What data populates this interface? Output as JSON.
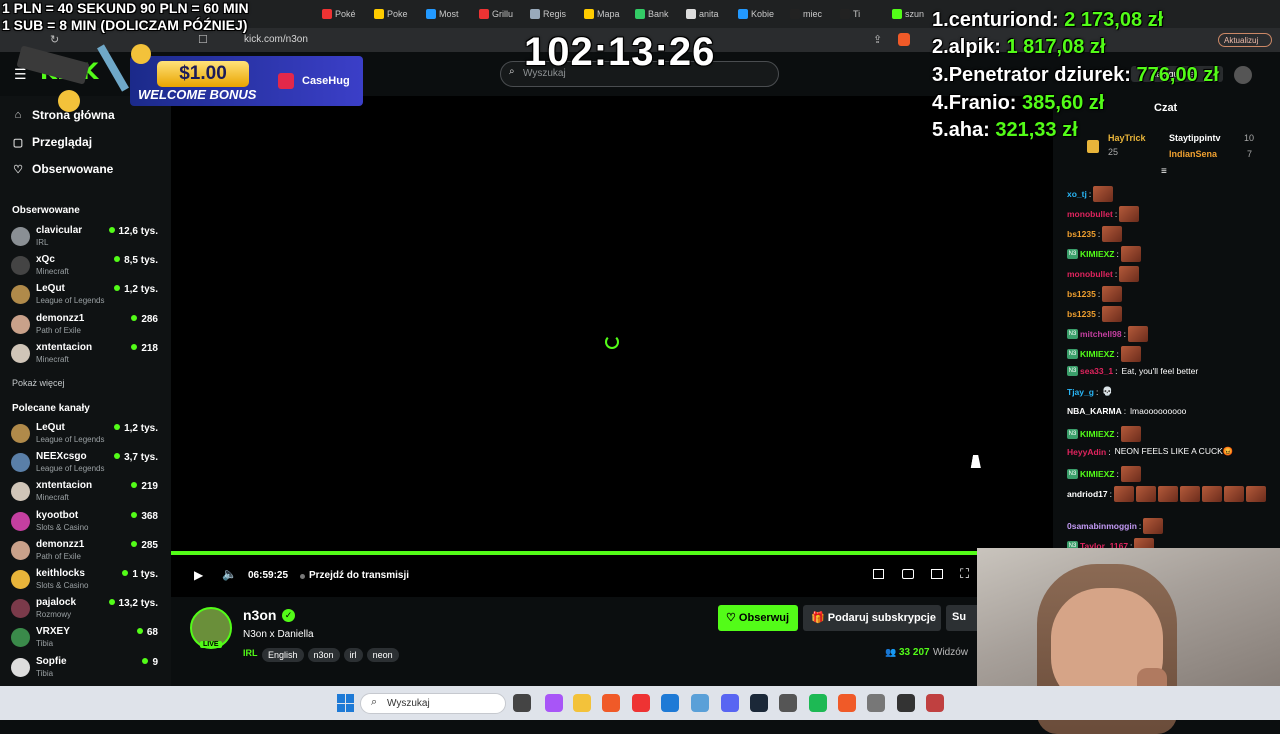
{
  "browser": {
    "tabs": [
      {
        "label": "Poké",
        "color": "#e33"
      },
      {
        "label": "Poke",
        "color": "#fc0"
      },
      {
        "label": "Most",
        "color": "#29f"
      },
      {
        "label": "Grillu",
        "color": "#e33"
      },
      {
        "label": "Regis",
        "color": "#9ab"
      },
      {
        "label": "Mapa",
        "color": "#fc0"
      },
      {
        "label": "Bank",
        "color": "#3c6"
      },
      {
        "label": "anita",
        "color": "#ddd"
      },
      {
        "label": "Kobie",
        "color": "#29f"
      },
      {
        "label": "miec",
        "color": "#222"
      },
      {
        "label": "Ti",
        "color": "#222"
      },
      {
        "label": "szun",
        "color": "#53fc18"
      }
    ],
    "url": "kick.com/n3on",
    "update_button": "Aktualizuj"
  },
  "overlay": {
    "donation_line1": "1 PLN =  40 SEKUND 90 PLN = 60 MIN",
    "donation_line2": "1 SUB = 8 MIN (DOLICZAM PÓŹNIEJ)",
    "timer": "102:13:26",
    "casehug_amount": "$1.00",
    "casehug_text": "WELCOME BONUS",
    "casehug_brand": "CaseHug",
    "leaderboard": [
      {
        "rank": "1.",
        "name": "centuriond:",
        "amount": "2 173,08 zł"
      },
      {
        "rank": "2.",
        "name": "alpik:",
        "amount": "1 817,08 zł"
      },
      {
        "rank": "3.",
        "name": "Penetrator dziurek:",
        "amount": "776,00 zł"
      },
      {
        "rank": "4.",
        "name": "Franio:",
        "amount": "385,60 zł"
      },
      {
        "rank": "5.",
        "name": "aha:",
        "amount": "321,33 zł"
      }
    ]
  },
  "header": {
    "search_placeholder": "Wyszukaj",
    "login_label": "Zaloguj się"
  },
  "sidebar": {
    "nav": [
      {
        "label": "Strona główna",
        "icon": "home-icon",
        "glyph": "⌂"
      },
      {
        "label": "Przeglądaj",
        "icon": "browse-icon",
        "glyph": "▢"
      },
      {
        "label": "Obserwowane",
        "icon": "heart-icon",
        "glyph": "♡"
      }
    ],
    "followed_title": "Obserwowane",
    "followed": [
      {
        "name": "clavicular",
        "category": "IRL",
        "viewers": "12,6 tys.",
        "color": "#8a8f94"
      },
      {
        "name": "xQc",
        "category": "Minecraft",
        "viewers": "8,5 tys.",
        "color": "#444"
      },
      {
        "name": "LeQut",
        "category": "League of Legends",
        "viewers": "1,2 tys.",
        "color": "#b08a4a"
      },
      {
        "name": "demonzz1",
        "category": "Path of Exile",
        "viewers": "286",
        "color": "#c9a18a"
      },
      {
        "name": "xntentacion",
        "category": "Minecraft",
        "viewers": "218",
        "color": "#d0c5b8"
      }
    ],
    "show_more": "Pokaż więcej",
    "recommended_title": "Polecane kanały",
    "recommended": [
      {
        "name": "LeQut",
        "category": "League of Legends",
        "viewers": "1,2 tys.",
        "color": "#b08a4a"
      },
      {
        "name": "NEEXcsgo",
        "category": "League of Legends",
        "viewers": "3,7 tys.",
        "color": "#5a7fa8"
      },
      {
        "name": "xntentacion",
        "category": "Minecraft",
        "viewers": "219",
        "color": "#d0c5b8"
      },
      {
        "name": "kyootbot",
        "category": "Slots & Casino",
        "viewers": "368",
        "color": "#c43fa0"
      },
      {
        "name": "demonzz1",
        "category": "Path of Exile",
        "viewers": "285",
        "color": "#c9a18a"
      },
      {
        "name": "keithlocks",
        "category": "Slots & Casino",
        "viewers": "1 tys.",
        "color": "#e8b43a"
      },
      {
        "name": "pajalock",
        "category": "Rozmowy",
        "viewers": "13,2 tys.",
        "color": "#7a3a4a"
      },
      {
        "name": "VRXEY",
        "category": "Tibia",
        "viewers": "68",
        "color": "#3a8a4a"
      },
      {
        "name": "Sopfie",
        "category": "Tibia",
        "viewers": "9",
        "color": "#ddd"
      }
    ]
  },
  "player": {
    "time": "06:59:25",
    "go_live": "Przejdź do transmisji",
    "progress": 1.0
  },
  "channel": {
    "name": "n3on",
    "title": "N3on x Daniella",
    "live_badge": "LIVE",
    "category": "IRL",
    "tags": [
      "English",
      "n3on",
      "irl",
      "neon"
    ],
    "follow_label": "Obserwuj",
    "gift_label": "Podaruj subskrypcje",
    "sub_label": "Su",
    "viewers": "33 207",
    "viewers_label": "Widzów"
  },
  "chat": {
    "title": "Czat",
    "top_gifters": [
      {
        "name": "HayTrick",
        "count": "25"
      },
      {
        "name": "Staytippintv",
        "count": "10"
      },
      {
        "name": "IndianSena",
        "count": "7"
      }
    ],
    "messages": [
      {
        "user": "xo_tj",
        "color": "#29b6f6",
        "text": "",
        "emotes": 1,
        "badge": false
      },
      {
        "user": "monobullet",
        "color": "#e0245e",
        "text": "",
        "emotes": 1,
        "badge": false
      },
      {
        "user": "bs1235",
        "color": "#f0a030",
        "text": "",
        "emotes": 1,
        "badge": false
      },
      {
        "user": "KIMIEXZ",
        "color": "#53fc18",
        "text": "",
        "emotes": 1,
        "badge": true
      },
      {
        "user": "monobullet",
        "color": "#e0245e",
        "text": "",
        "emotes": 1,
        "badge": false
      },
      {
        "user": "bs1235",
        "color": "#f0a030",
        "text": "",
        "emotes": 1,
        "badge": false
      },
      {
        "user": "bs1235",
        "color": "#f0a030",
        "text": "",
        "emotes": 1,
        "badge": false
      },
      {
        "user": "mitchell98",
        "color": "#c43fa0",
        "text": "",
        "emotes": 1,
        "badge": true
      },
      {
        "user": "KIMIEXZ",
        "color": "#53fc18",
        "text": "",
        "emotes": 1,
        "badge": true
      },
      {
        "user": "sea33_1",
        "color": "#e0245e",
        "text": "Eat, you'll feel better",
        "emotes": 0,
        "badge": true
      },
      {
        "user": "Tjay_g",
        "color": "#29b6f6",
        "text": "💀",
        "emotes": 0,
        "badge": false
      },
      {
        "user": "NBA_KARMA",
        "color": "#ffffff",
        "text": "lmaooooooooo",
        "emotes": 0,
        "badge": false
      },
      {
        "user": "KIMIEXZ",
        "color": "#53fc18",
        "text": "",
        "emotes": 1,
        "badge": true
      },
      {
        "user": "HeyyAdin",
        "color": "#e0245e",
        "text": "NEON FEELS LIKE A CUCK😡",
        "emotes": 0,
        "badge": false
      },
      {
        "user": "KIMIEXZ",
        "color": "#53fc18",
        "text": "",
        "emotes": 1,
        "badge": true
      },
      {
        "user": "andriod17",
        "color": "#ffffff",
        "text": "",
        "emotes": 7,
        "badge": false
      },
      {
        "user": "0samabinmoggin",
        "color": "#c39af5",
        "text": "",
        "emotes": 1,
        "badge": false
      },
      {
        "user": "Taylor_1167",
        "color": "#e0245e",
        "text": "",
        "emotes": 1,
        "badge": true
      }
    ]
  },
  "taskbar": {
    "search_placeholder": "Wyszukaj",
    "icons": [
      {
        "name": "windows-start-icon",
        "color": "#1e7ad6"
      },
      {
        "name": "taskview-icon",
        "color": "#444"
      },
      {
        "name": "copilot-icon",
        "color": "#a855f7"
      },
      {
        "name": "file-explorer-icon",
        "color": "#f3c23a"
      },
      {
        "name": "brave-icon",
        "color": "#f05a28"
      },
      {
        "name": "chrome-icon",
        "color": "#e33"
      },
      {
        "name": "store-icon",
        "color": "#1e7ad6"
      },
      {
        "name": "notepad-icon",
        "color": "#5aa0d8"
      },
      {
        "name": "discord-icon",
        "color": "#5865f2"
      },
      {
        "name": "steam-icon",
        "color": "#1b2838"
      },
      {
        "name": "calculator-icon",
        "color": "#555"
      },
      {
        "name": "spotify-icon",
        "color": "#1db954"
      },
      {
        "name": "brave-2-icon",
        "color": "#f05a28"
      },
      {
        "name": "settings-icon",
        "color": "#777"
      },
      {
        "name": "obs-icon",
        "color": "#333"
      },
      {
        "name": "app-icon",
        "color": "#c04040"
      }
    ]
  }
}
